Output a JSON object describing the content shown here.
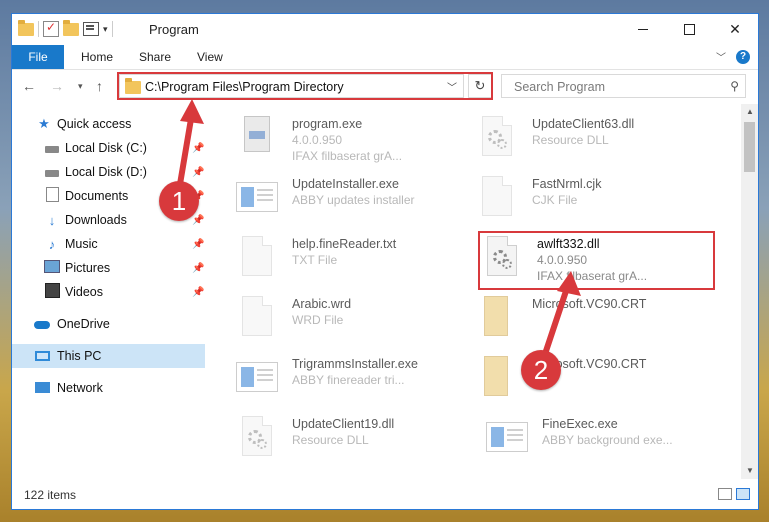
{
  "window": {
    "title": "Program"
  },
  "ribbon": {
    "tabs": [
      "File",
      "Home",
      "Share",
      "View"
    ]
  },
  "address": {
    "path": "C:\\Program Files\\Program Directory"
  },
  "search": {
    "placeholder": "Search Program"
  },
  "sidebar": {
    "items": [
      {
        "label": "Quick access",
        "icon": "star-icon"
      },
      {
        "label": "Local Disk (C:)",
        "icon": "drive-icon"
      },
      {
        "label": "Local Disk (D:)",
        "icon": "drive-icon"
      },
      {
        "label": "Documents",
        "icon": "document-icon"
      },
      {
        "label": "Downloads",
        "icon": "download-icon"
      },
      {
        "label": "Music",
        "icon": "music-icon"
      },
      {
        "label": "Pictures",
        "icon": "pictures-icon"
      },
      {
        "label": "Videos",
        "icon": "videos-icon"
      },
      {
        "label": "OneDrive",
        "icon": "cloud-icon"
      },
      {
        "label": "This PC",
        "icon": "computer-icon"
      },
      {
        "label": "Network",
        "icon": "network-icon"
      }
    ]
  },
  "files": [
    {
      "name": "program.exe",
      "line2": "4.0.0.950",
      "line3": "IFAX filbaserat grA...",
      "icon": "exe-icon"
    },
    {
      "name": "UpdateClient63.dll",
      "line2": "Resource DLL",
      "line3": "",
      "icon": "dll-gear-icon"
    },
    {
      "name": "UpdateInstaller.exe",
      "line2": "ABBY updates installer",
      "line3": "",
      "icon": "app-window-icon"
    },
    {
      "name": "FastNrml.cjk",
      "line2": "CJK File",
      "line3": "",
      "icon": "blank-file-icon"
    },
    {
      "name": "help.fineReader.txt",
      "line2": "TXT File",
      "line3": "",
      "icon": "text-file-icon"
    },
    {
      "name": "awlft332.dll",
      "line2": "4.0.0.950",
      "line3": "IFAX filbaserat grA...",
      "icon": "dll-gear-icon"
    },
    {
      "name": "Arabic.wrd",
      "line2": "WRD File",
      "line3": "",
      "icon": "blank-file-icon"
    },
    {
      "name": "Microsoft.VC90.CRT",
      "line2": "",
      "line3": "",
      "icon": "folder-icon"
    },
    {
      "name": "TrigrammsInstaller.exe",
      "line2": "ABBY finereader tri...",
      "line3": "",
      "icon": "app-window-icon"
    },
    {
      "name": "Microsoft.VC90.CRT",
      "line2": "",
      "line3": "",
      "icon": "folder-icon"
    },
    {
      "name": "UpdateClient19.dll",
      "line2": "Resource DLL",
      "line3": "",
      "icon": "dll-gear-icon"
    },
    {
      "name": "FineExec.exe",
      "line2": "ABBY background exe...",
      "line3": "",
      "icon": "app-window-icon"
    }
  ],
  "status": {
    "count": "122 items"
  },
  "callouts": [
    "1",
    "2"
  ],
  "colors": {
    "accent": "#1979ca",
    "highlight": "#d8393c",
    "selection": "#cce4f7"
  }
}
